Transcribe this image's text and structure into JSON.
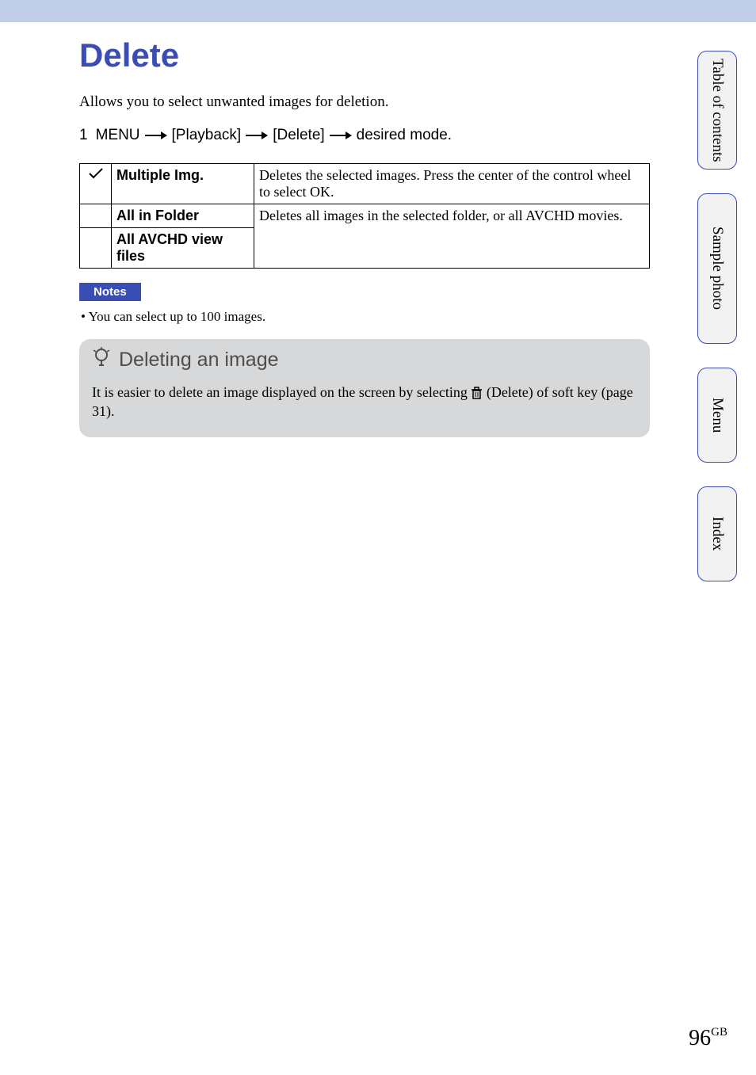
{
  "title": "Delete",
  "intro": "Allows you to select unwanted images for deletion.",
  "step": {
    "num": "1",
    "parts": [
      "MENU",
      "[Playback]",
      "[Delete]",
      "desired mode."
    ]
  },
  "table": {
    "rows": [
      {
        "check": true,
        "label": "Multiple Img.",
        "desc": "Deletes the selected images. Press the center of the control wheel to select OK."
      },
      {
        "check": false,
        "label": "All in Folder",
        "desc": "Deletes all images in the selected folder, or all AVCHD movies."
      },
      {
        "check": false,
        "label": "All AVCHD view files",
        "desc": ""
      }
    ]
  },
  "notes": {
    "label": "Notes",
    "items": [
      "You can select up to 100 images."
    ]
  },
  "tip": {
    "title": "Deleting an image",
    "body_before": "It is easier to delete an image displayed on the screen by selecting ",
    "body_after": " (Delete) of soft key (page 31)."
  },
  "tabs": {
    "toc": "Table of contents",
    "sample": "Sample photo",
    "menu": "Menu",
    "index": "Index"
  },
  "page_number": "96",
  "page_suffix": "GB"
}
